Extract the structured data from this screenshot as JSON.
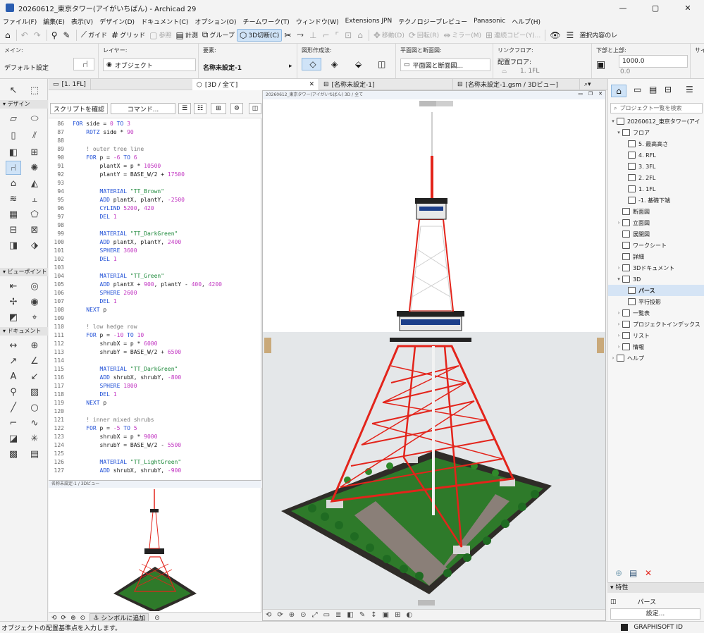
{
  "window": {
    "title": "20260612_東京タワー(アイがいちばん) - Archicad 29",
    "controls": [
      "—",
      "▢",
      "✕"
    ]
  },
  "menu": [
    "ファイル(F)",
    "編集(E)",
    "表示(V)",
    "デザイン(D)",
    "ドキュメント(C)",
    "オプション(O)",
    "チームワーク(T)",
    "ウィンドウ(W)",
    "Extensions JPN",
    "テクノロジープレビュー",
    "Panasonic",
    "ヘルプ(H)"
  ],
  "toolbar": {
    "guide": "ガイド",
    "grid": "グリッド",
    "reference": "参照",
    "measure": "計測",
    "group": "グループ",
    "section3d": "3D切断(C)",
    "move": "移動(D)",
    "rotate": "回転(R)",
    "mirror": "ミラー(M)",
    "multiply": "連続コピー(Y)...",
    "select_info": "選択内容のレ"
  },
  "infobox": {
    "main_label": "メイン:",
    "default_settings": "デフォルト設定",
    "layer_label": "レイヤー:",
    "layer_value": "オブジェクト",
    "element_label": "要素:",
    "element_value": "名称未設定-1",
    "geometry_label": "図形作成法:",
    "plan_section_label": "平面図と断面図:",
    "plan_section_value": "平面図と断面図...",
    "link_floor_label": "リンクフロア:",
    "placement_floor_label": "配置フロア:",
    "placement_floor_value": "1. 1FL",
    "top_bottom_label": "下部と上部:",
    "top_value": "1000.0",
    "bottom_value": "0.0",
    "size_label": "サイズ"
  },
  "tabs": {
    "floor": "[1. 1FL]",
    "view3d": "[3D / 全て]",
    "gsm": "[名称未設定-1]",
    "gsm3d": "[名称未設定-1.gsm / 3Dビュー]"
  },
  "toolbox": {
    "section_design": "デザイン",
    "section_viewpoint": "ビューポイント",
    "section_document": "ドキュメント"
  },
  "editor": {
    "check_script": "スクリプトを確認",
    "command": "コマンド...",
    "lines": [
      {
        "n": "86",
        "t": "FOR side = 0 TO 3"
      },
      {
        "n": "87",
        "t": "    ROTZ side * 90"
      },
      {
        "n": "88",
        "t": ""
      },
      {
        "n": "89",
        "t": "    ! outer tree line"
      },
      {
        "n": "90",
        "t": "    FOR p = -6 TO 6"
      },
      {
        "n": "91",
        "t": "        plantX = p * 10500"
      },
      {
        "n": "92",
        "t": "        plantY = BASE_W/2 + 17500"
      },
      {
        "n": "93",
        "t": ""
      },
      {
        "n": "94",
        "t": "        MATERIAL \"TT_Brown\""
      },
      {
        "n": "95",
        "t": "        ADD plantX, plantY, -2500"
      },
      {
        "n": "96",
        "t": "        CYLIND 5200, 420"
      },
      {
        "n": "97",
        "t": "        DEL 1"
      },
      {
        "n": "98",
        "t": ""
      },
      {
        "n": "99",
        "t": "        MATERIAL \"TT_DarkGreen\""
      },
      {
        "n": "100",
        "t": "        ADD plantX, plantY, 2400"
      },
      {
        "n": "101",
        "t": "        SPHERE 3600"
      },
      {
        "n": "102",
        "t": "        DEL 1"
      },
      {
        "n": "103",
        "t": ""
      },
      {
        "n": "104",
        "t": "        MATERIAL \"TT_Green\""
      },
      {
        "n": "105",
        "t": "        ADD plantX + 900, plantY - 400, 4200"
      },
      {
        "n": "106",
        "t": "        SPHERE 2600"
      },
      {
        "n": "107",
        "t": "        DEL 1"
      },
      {
        "n": "108",
        "t": "    NEXT p"
      },
      {
        "n": "109",
        "t": ""
      },
      {
        "n": "110",
        "t": "    ! low hedge row"
      },
      {
        "n": "111",
        "t": "    FOR p = -10 TO 10"
      },
      {
        "n": "112",
        "t": "        shrubX = p * 6000"
      },
      {
        "n": "113",
        "t": "        shrubY = BASE_W/2 + 6500"
      },
      {
        "n": "114",
        "t": ""
      },
      {
        "n": "115",
        "t": "        MATERIAL \"TT_DarkGreen\""
      },
      {
        "n": "116",
        "t": "        ADD shrubX, shrubY, -800"
      },
      {
        "n": "117",
        "t": "        SPHERE 1800"
      },
      {
        "n": "118",
        "t": "        DEL 1"
      },
      {
        "n": "119",
        "t": "    NEXT p"
      },
      {
        "n": "120",
        "t": ""
      },
      {
        "n": "121",
        "t": "    ! inner mixed shrubs"
      },
      {
        "n": "122",
        "t": "    FOR p = -5 TO 5"
      },
      {
        "n": "123",
        "t": "        shrubX = p * 9000"
      },
      {
        "n": "124",
        "t": "        shrubY = BASE_W/2 - 5500"
      },
      {
        "n": "125",
        "t": ""
      },
      {
        "n": "126",
        "t": "        MATERIAL \"TT_LightGreen\""
      },
      {
        "n": "127",
        "t": "        ADD shrubX, shrubY, -900"
      }
    ]
  },
  "mini_preview": {
    "title": "名称未設定-1 / 3Dビュー",
    "add_to_symbol": "シンボルに追加"
  },
  "view3d": {
    "title": "20260612_東京タワー(アイがいちばん) 3D / 全て"
  },
  "navigator": {
    "search_placeholder": "プロジェクト一覧を検索",
    "project": "20260612_東京タワー(アイ",
    "floors_label": "フロア",
    "floors": [
      "5. 最高高さ",
      "4. RFL",
      "3. 3FL",
      "2. 2FL",
      "1. 1FL",
      "-1. 基礎下端"
    ],
    "sections": "断面図",
    "elevations": "立面図",
    "interior_elevations": "展開図",
    "worksheets": "ワークシート",
    "details": "詳細",
    "documents3d": "3Dドキュメント",
    "view3d": "3D",
    "perspective": "パース",
    "axonometry": "平行投影",
    "schedules": "一覧表",
    "project_indexes": "プロジェクトインデックス",
    "lists": "リスト",
    "info": "情報",
    "help": "ヘルプ"
  },
  "properties": {
    "header": "特性",
    "value": "パース",
    "settings": "設定..."
  },
  "status": {
    "message": "オブジェクトの配置基準点を入力します。",
    "brand": "GRAPHISOFT ID"
  },
  "colors": {
    "tower_red": "#e3241b",
    "tower_white": "#d8d8d8",
    "ground_green": "#2e7a2a",
    "tree_green": "#1f6b22",
    "base_dark": "#2f2c28",
    "selection_blue": "#cfe3f7"
  }
}
